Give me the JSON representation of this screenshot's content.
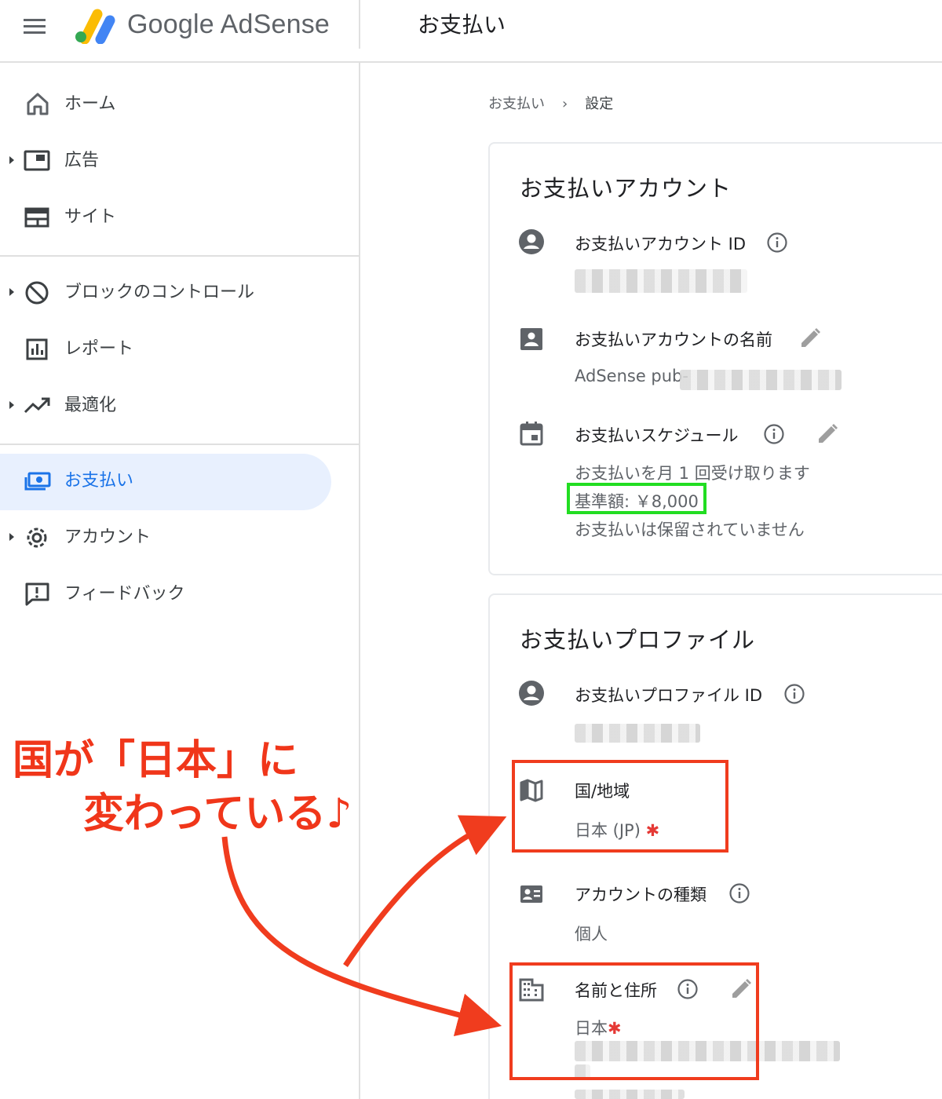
{
  "header": {
    "brand": "Google AdSense",
    "title": "お支払い"
  },
  "sidebar": {
    "items": [
      {
        "label": "ホーム",
        "icon": "home-icon"
      },
      {
        "label": "広告",
        "icon": "ads-icon"
      },
      {
        "label": "サイト",
        "icon": "sites-icon"
      },
      {
        "label": "ブロックのコントロール",
        "icon": "block-icon"
      },
      {
        "label": "レポート",
        "icon": "report-icon"
      },
      {
        "label": "最適化",
        "icon": "trending-up-icon"
      },
      {
        "label": "お支払い",
        "icon": "payments-icon",
        "active": true
      },
      {
        "label": "アカウント",
        "icon": "gear-icon"
      },
      {
        "label": "フィードバック",
        "icon": "feedback-icon"
      }
    ]
  },
  "breadcrumb": {
    "parent": "お支払い",
    "separator": "›",
    "current": "設定"
  },
  "payments_account": {
    "title": "お支払いアカウント",
    "account_id_label": "お支払いアカウント ID",
    "account_name_label": "お支払いアカウントの名前",
    "account_name_value": "AdSense pub-",
    "schedule_label": "お支払いスケジュール",
    "schedule_line1": "お支払いを月 1 回受け取ります",
    "schedule_threshold": "基準額: ￥8,000",
    "schedule_line3": "お支払いは保留されていません"
  },
  "payments_profile": {
    "title": "お支払いプロファイル",
    "profile_id_label": "お支払いプロファイル ID",
    "country_label": "国/地域",
    "country_value": "日本 (JP)",
    "account_type_label": "アカウントの種類",
    "account_type_value": "個人",
    "name_address_label": "名前と住所",
    "name_address_value": "日本",
    "required_mark": "✱"
  },
  "annotation": {
    "line1": "国が「日本」に",
    "line2": "変わっている♪"
  },
  "colors": {
    "accent": "#1a73e8",
    "active_bg": "#e8f0fe",
    "highlight_green": "#22dd22",
    "highlight_red": "#f03c1e"
  }
}
